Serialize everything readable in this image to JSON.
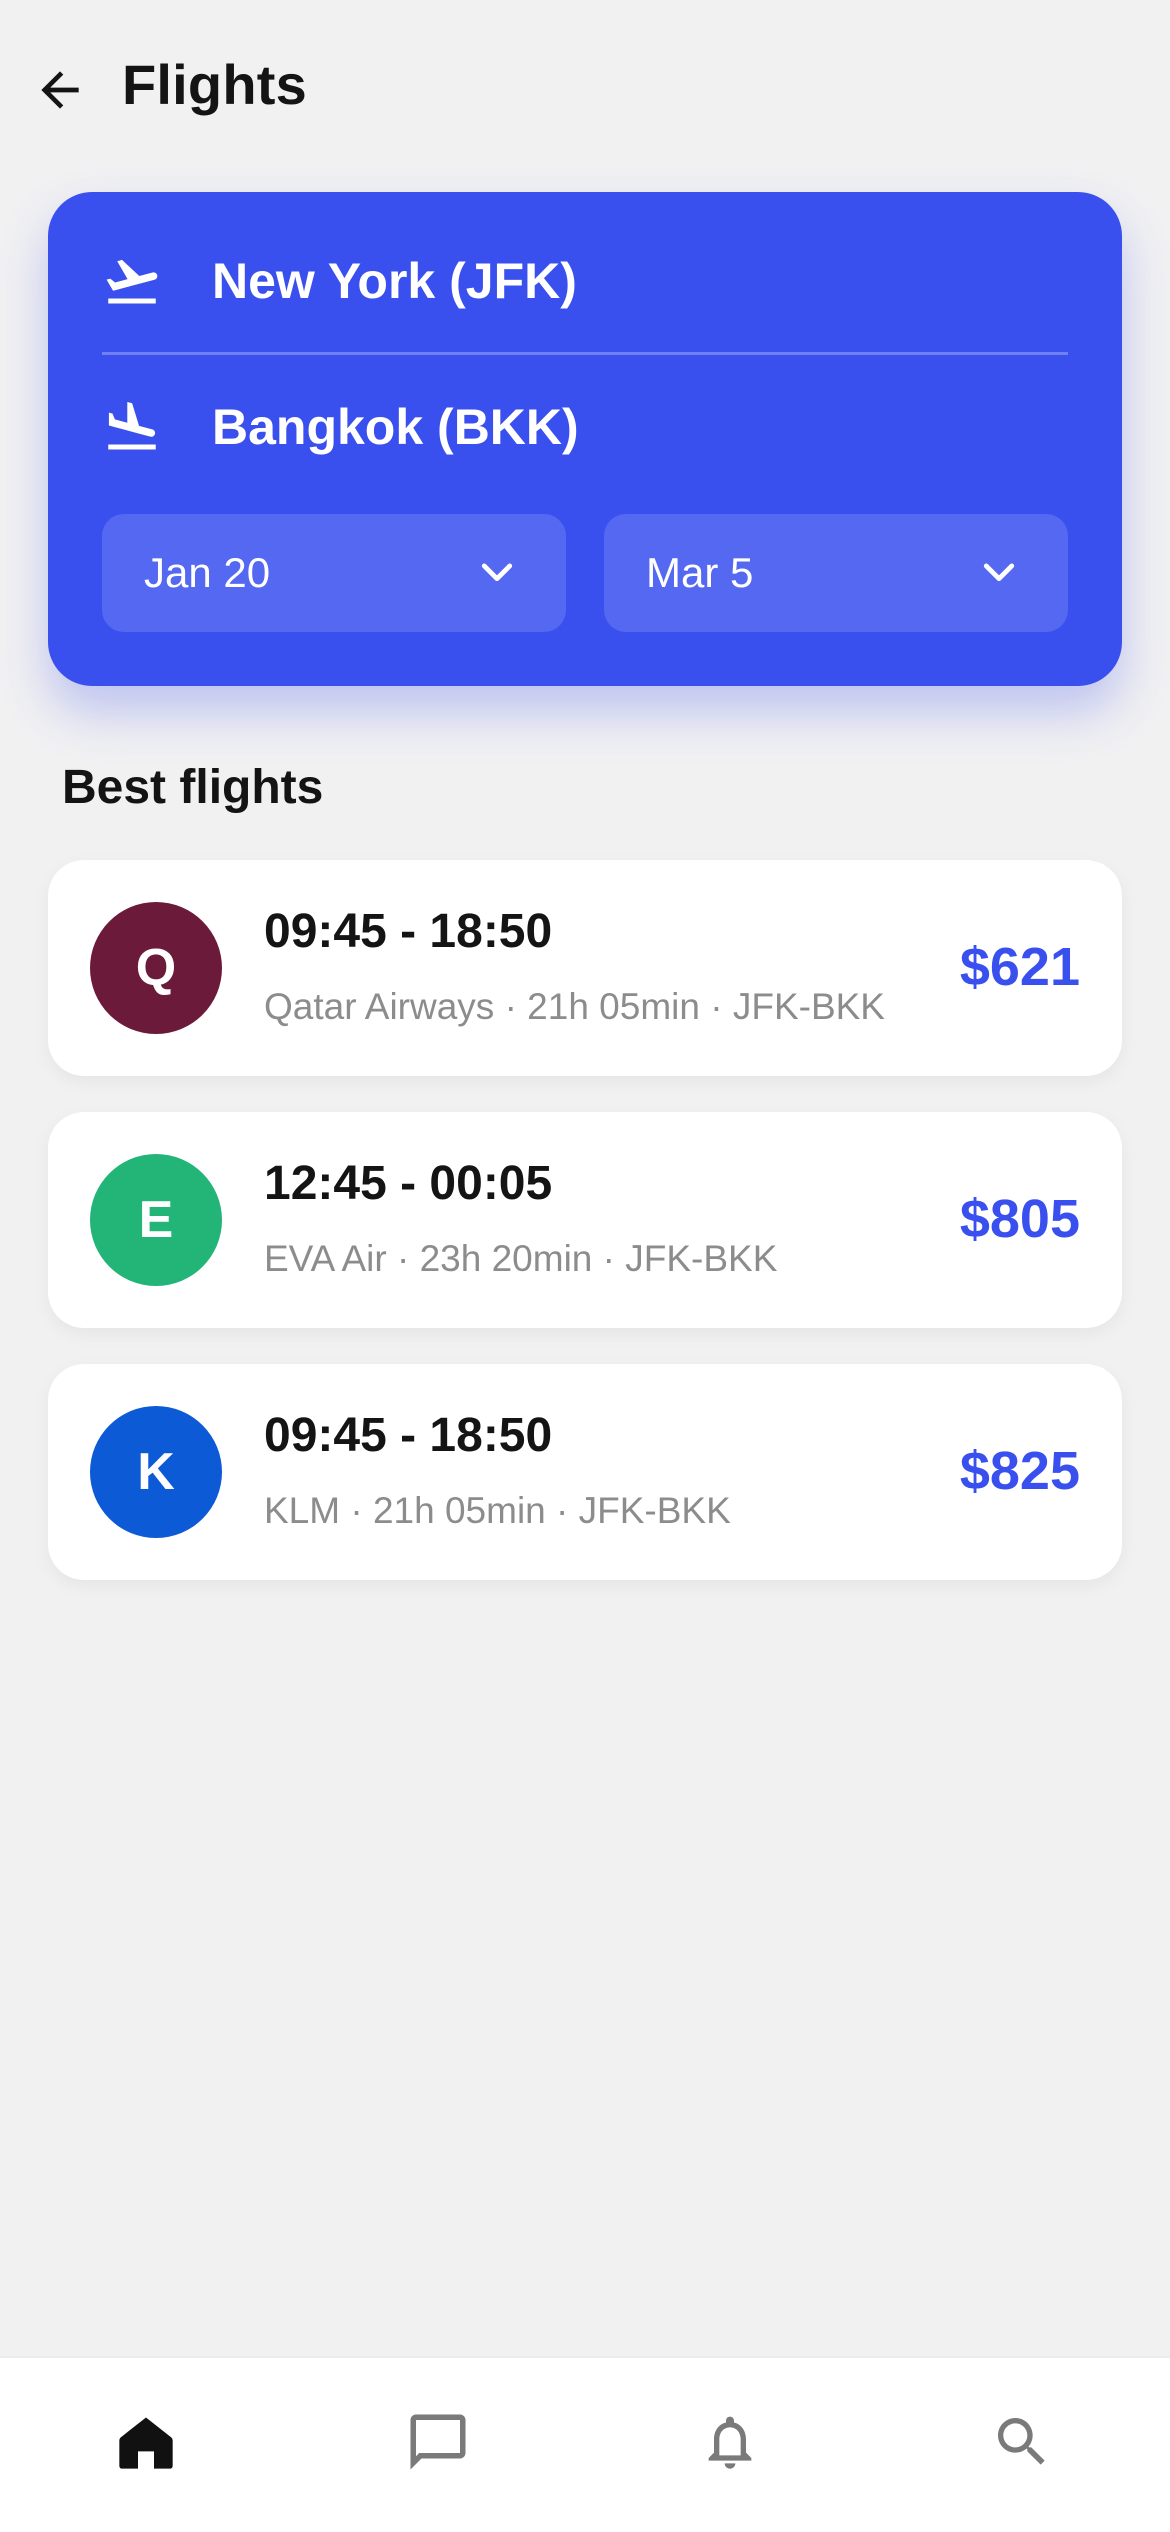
{
  "header": {
    "title": "Flights",
    "back_icon": "arrow-left-icon"
  },
  "search": {
    "from": {
      "label": "New York (JFK)",
      "icon": "flight-takeoff-icon"
    },
    "to": {
      "label": "Bangkok (BKK)",
      "icon": "flight-land-icon"
    },
    "depart_date": "Jan 20",
    "return_date": "Mar 5"
  },
  "results": {
    "section_title": "Best flights",
    "flights": [
      {
        "logo_letter": "Q",
        "logo_color": "#6b1a3a",
        "times": "09:45 - 18:50",
        "meta": "Qatar Airways · 21h 05min · JFK-BKK",
        "price": "$621"
      },
      {
        "logo_letter": "E",
        "logo_color": "#23b477",
        "times": "12:45 - 00:05",
        "meta": "EVA Air · 23h 20min · JFK-BKK",
        "price": "$805"
      },
      {
        "logo_letter": "K",
        "logo_color": "#0c5ad6",
        "times": "09:45 - 18:50",
        "meta": "KLM · 21h 05min · JFK-BKK",
        "price": "$825"
      }
    ]
  },
  "bottom_nav": {
    "items": [
      "home-icon",
      "chat-icon",
      "bell-icon",
      "search-icon"
    ],
    "active": "home-icon"
  },
  "colors": {
    "accent": "#3a50ee",
    "background": "#f1f1f2",
    "card": "#ffffff"
  }
}
